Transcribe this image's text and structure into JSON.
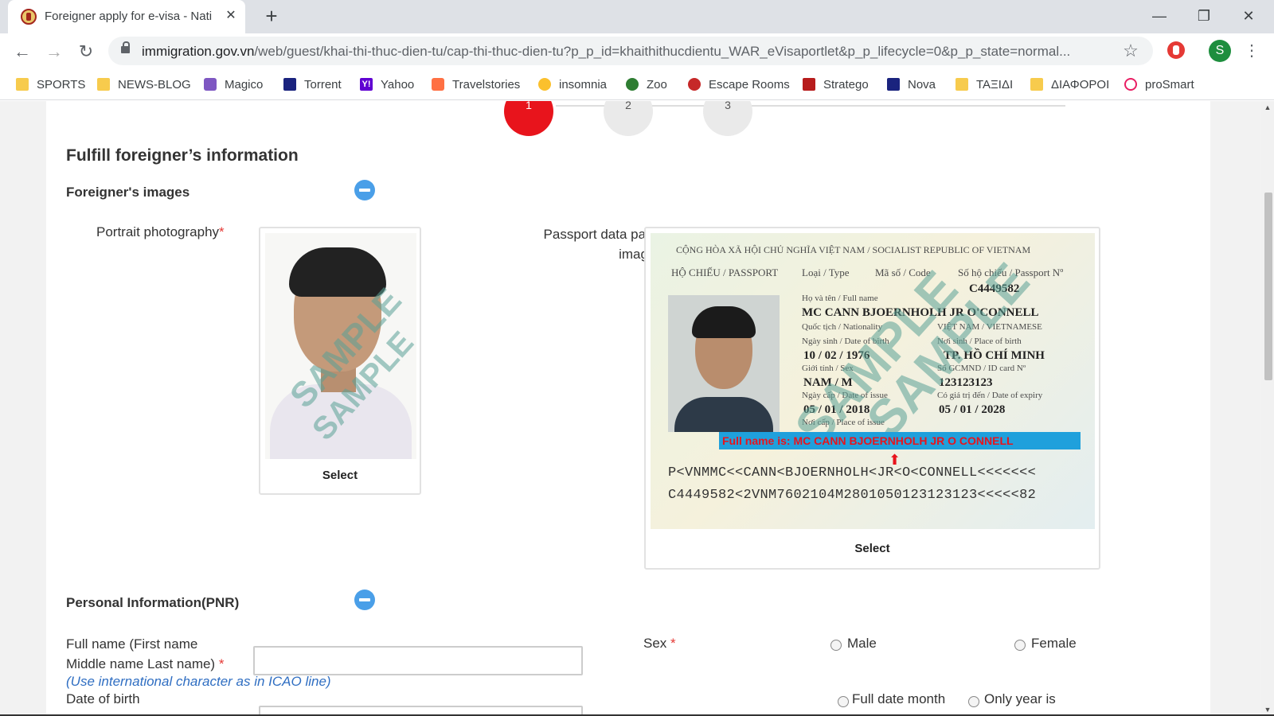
{
  "browser": {
    "tab_title": "Foreigner apply for e-visa - Nati",
    "tab_close": "✕",
    "new_tab": "+",
    "url_host": "immigration.gov.vn",
    "url_path": "/web/guest/khai-thi-thuc-dien-tu/cap-thi-thuc-dien-tu?p_p_id=khaithithucdientu_WAR_eVisaportlet&p_p_lifecycle=0&p_p_state=normal...",
    "profile_initial": "S",
    "bookmarks": [
      {
        "label": "SPORTS",
        "icon": "folder-icon"
      },
      {
        "label": "NEWS-BLOG",
        "icon": "folder-icon"
      },
      {
        "label": "Magico",
        "icon": "magico-icon"
      },
      {
        "label": "Torrent",
        "icon": "torrent-icon"
      },
      {
        "label": "Yahoo",
        "icon": "yahoo-icon"
      },
      {
        "label": "Travelstories",
        "icon": "plane-icon"
      },
      {
        "label": "insomnia",
        "icon": "insomnia-icon"
      },
      {
        "label": "Zoo",
        "icon": "zoo-icon"
      },
      {
        "label": "Escape Rooms",
        "icon": "escape-icon"
      },
      {
        "label": "Stratego",
        "icon": "stratego-icon"
      },
      {
        "label": "Nova",
        "icon": "nova-icon"
      },
      {
        "label": "ΤΑΞΙΔΙ",
        "icon": "folder-icon"
      },
      {
        "label": "ΔΙΑΦΟΡΟΙ",
        "icon": "folder-icon"
      },
      {
        "label": "proSmart",
        "icon": "prosmart-icon"
      }
    ]
  },
  "steps": [
    "1",
    "2",
    "3"
  ],
  "active_step": "1",
  "page": {
    "section_title": "Fulfill foreigner’s information",
    "images_heading": "Foreigner's images",
    "portrait_label": "Portrait photography",
    "passport_label_line1": "Passport data page",
    "passport_label_line2": "image",
    "required_mark": "*",
    "select_label": "Select",
    "watermark": "SAMPLE",
    "personal_heading": "Personal Information(PNR)",
    "fullname_label_line1": "Full name (First name",
    "fullname_label_line2": "Middle name Last name)",
    "fullname_hint": "(Use international character as in ICAO line)",
    "fullname_value": "",
    "sex_label": "Sex",
    "sex_options": [
      "Male",
      "Female"
    ],
    "dob_label": "Date of birth",
    "dob_options": [
      "Full date month",
      "Only year is"
    ]
  },
  "passport_sample": {
    "header": "CỘNG HÒA XÃ HỘI CHỦ NGHĨA VIỆT NAM / SOCIALIST REPUBLIC OF VIETNAM",
    "doc_label": "HỘ CHIẾU / PASSPORT",
    "type_label": "Loại / Type",
    "code_label": "Mã số / Code",
    "passport_no_label": "Số hộ chiếu / Passport Nº",
    "passport_no": "C4449582",
    "fullname_label": "Họ và tên / Full name",
    "fullname": "MC CANN BJOERNHOLH JR O'CONNELL",
    "nationality_label": "Quốc tịch / Nationality",
    "nationality": "VIỆT NAM / VIETNAMESE",
    "dob_label": "Ngày sinh / Date of birth",
    "dob": "10 / 02 / 1976",
    "pob_label": "Nơi sinh / Place of birth",
    "pob": "TP. HỒ CHÍ MINH",
    "sex_label": "Giới tính / Sex",
    "sex": "NAM / M",
    "id_label": "Số GCMND / ID card Nº",
    "id": "123123123",
    "doi_label": "Ngày cấp / Date of issue",
    "doi": "05 / 01 / 2018",
    "doe_label": "Có giá trị đến / Date of expiry",
    "doe": "05 / 01 / 2028",
    "poi_label": "Nơi cấp / Place of issue",
    "banner": "Full name is: MC CANN BJOERNHOLH JR O CONNELL",
    "mrz_line1": "P<VNMMC<<CANN<BJOERNHOLH<JR<O<CONNELL<<<<<<<",
    "mrz_line2": "C4449582<2VNM7602104M2801050123123123<<<<<82"
  }
}
